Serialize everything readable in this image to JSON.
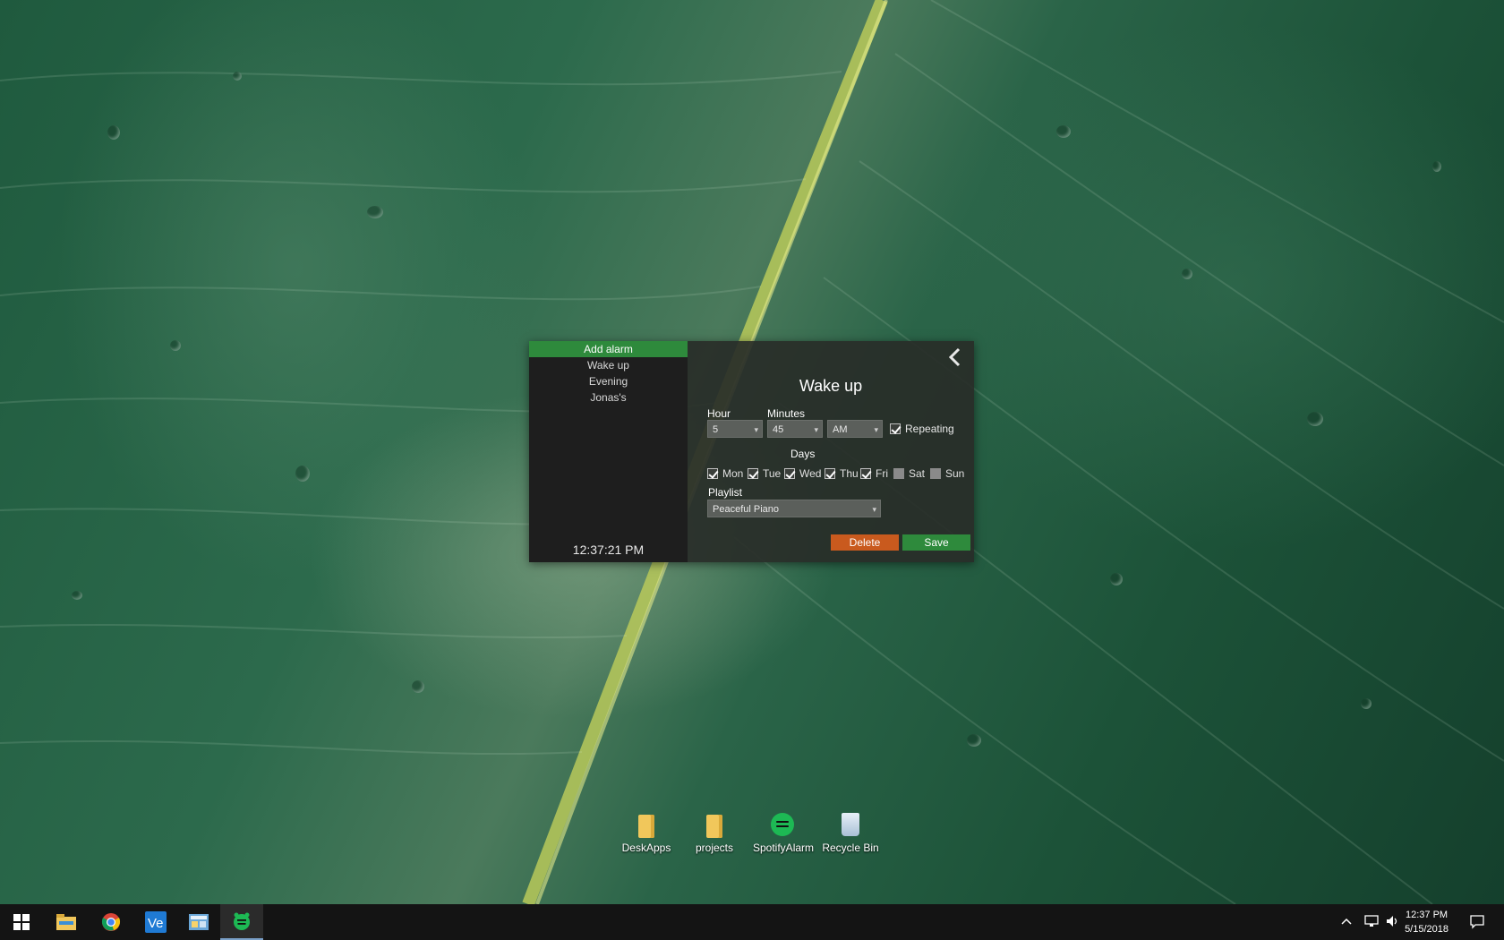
{
  "sidebar": {
    "items": [
      {
        "label": "Add alarm",
        "active": true
      },
      {
        "label": "Wake up"
      },
      {
        "label": "Evening"
      },
      {
        "label": "Jonas's"
      }
    ],
    "clock": "12:37:21 PM"
  },
  "editor": {
    "title": "Wake up",
    "hour_label": "Hour",
    "hour_value": "5",
    "minutes_label": "Minutes",
    "minutes_value": "45",
    "ampm_value": "AM",
    "repeating_label": "Repeating",
    "repeating_checked": true,
    "days_label": "Days",
    "days": [
      {
        "label": "Mon",
        "checked": true
      },
      {
        "label": "Tue",
        "checked": true
      },
      {
        "label": "Wed",
        "checked": true
      },
      {
        "label": "Thu",
        "checked": true
      },
      {
        "label": "Fri",
        "checked": true
      },
      {
        "label": "Sat",
        "checked": false
      },
      {
        "label": "Sun",
        "checked": false
      }
    ],
    "playlist_label": "Playlist",
    "playlist_value": "Peaceful Piano",
    "delete_label": "Delete",
    "save_label": "Save"
  },
  "desktop_icons": [
    {
      "label": "DeskApps",
      "icon": "folder-icon"
    },
    {
      "label": "projects",
      "icon": "folder-icon"
    },
    {
      "label": "SpotifyAlarm",
      "icon": "spotify-alarm-icon"
    },
    {
      "label": "Recycle Bin",
      "icon": "recycle-bin-icon"
    }
  ],
  "taskbar": {
    "apps": [
      "windows-start-icon",
      "file-explorer-icon",
      "chrome-icon",
      "ve-app-icon",
      "control-panel-icon",
      "spotify-alarm-icon"
    ],
    "time": "12:37 PM",
    "date": "5/15/2018"
  },
  "colors": {
    "accent_green": "#2e8a3c",
    "delete_orange": "#c95a1e",
    "sidebar_bg": "#1e1e1e",
    "panel_bg": "#282c28"
  }
}
